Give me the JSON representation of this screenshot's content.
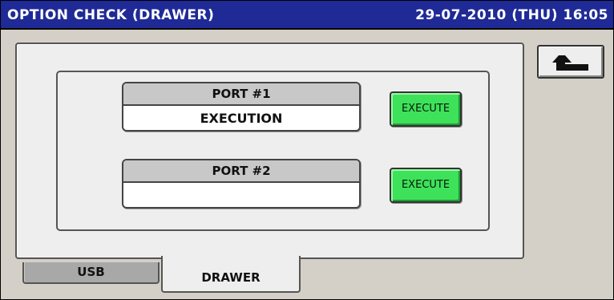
{
  "header": {
    "title": "OPTION CHECK (DRAWER)",
    "datetime": "29-07-2010 (THU)  16:05"
  },
  "ports": [
    {
      "label": "PORT #1",
      "status": "EXECUTION",
      "button_label": "EXECUTE"
    },
    {
      "label": "PORT #2",
      "status": "",
      "button_label": "EXECUTE"
    }
  ],
  "back_button": {
    "icon": "return-arrow-icon"
  },
  "tabs": [
    {
      "label": "USB",
      "active": false
    },
    {
      "label": "DRAWER",
      "active": true
    }
  ],
  "colors": {
    "titlebar": "#1f2a96",
    "execute_button": "#3de25a",
    "panel": "#eeeeee",
    "background": "#d4d0c8"
  }
}
